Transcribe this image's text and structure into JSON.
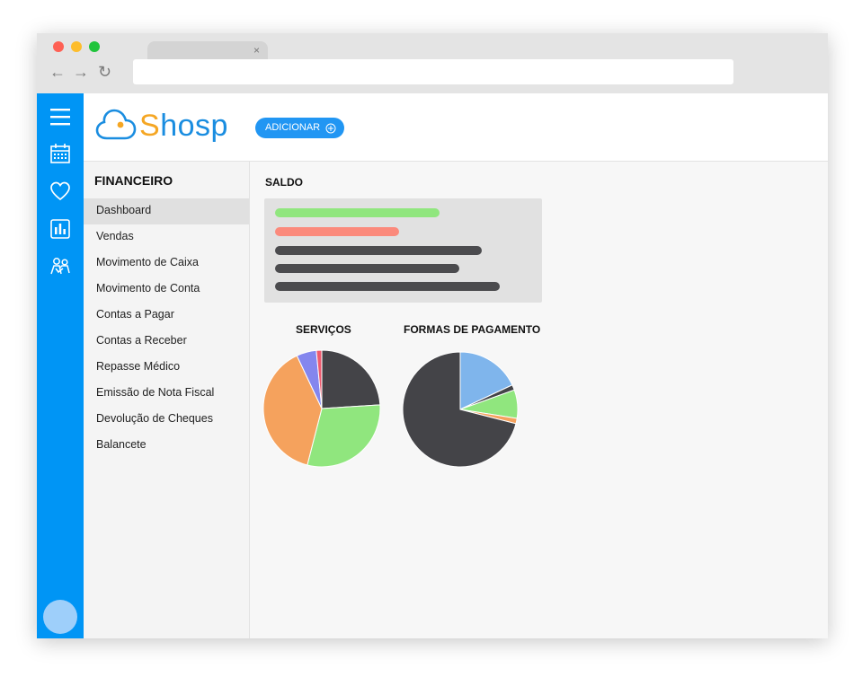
{
  "colors": {
    "accent": "#0095f5",
    "button": "#2196f3",
    "logo_blue": "#1a8de0",
    "logo_orange": "#f5a623",
    "dot_red": "#fe6054",
    "dot_yellow": "#fdbd2c",
    "dot_green": "#20c43b"
  },
  "browser": {
    "tab_close": "×",
    "back_icon": "←",
    "forward_icon": "→",
    "reload_icon": "↻",
    "url": ""
  },
  "sidebar_icons": [
    "menu-icon",
    "calendar-icon",
    "heart-icon",
    "bar-chart-icon",
    "people-icon"
  ],
  "header": {
    "logo_prefix": "S",
    "logo_rest": "hosp",
    "add_button": "ADICIONAR"
  },
  "menu": {
    "title": "FINANCEIRO",
    "items": [
      {
        "label": "Dashboard",
        "active": true
      },
      {
        "label": "Vendas"
      },
      {
        "label": "Movimento de Caixa"
      },
      {
        "label": "Movimento de Conta"
      },
      {
        "label": "Contas a Pagar"
      },
      {
        "label": "Contas a Receber"
      },
      {
        "label": "Repasse Médico"
      },
      {
        "label": "Emissão de Nota Fiscal"
      },
      {
        "label": "Devolução de Cheques"
      },
      {
        "label": "Balancete"
      }
    ]
  },
  "dashboard": {
    "saldo_title": "SALDO",
    "saldo_bars": [
      {
        "color": "#90e67e",
        "fraction": 0.73
      },
      {
        "color": "#fb8a7c",
        "fraction": 0.55
      },
      {
        "color": "#4b4b4e",
        "fraction": 0.92
      },
      {
        "color": "#4b4b4e",
        "fraction": 0.82
      },
      {
        "color": "#4b4b4e",
        "fraction": 1.0
      }
    ],
    "servicos_title": "SERVIÇOS",
    "pagamento_title": "FORMAS DE PAGAMENTO"
  },
  "chart_data": [
    {
      "type": "pie",
      "title": "SERVIÇOS",
      "slices": [
        {
          "value": 24,
          "color": "#444448"
        },
        {
          "value": 30,
          "color": "#90e67e"
        },
        {
          "value": 39,
          "color": "#f5a25d"
        },
        {
          "value": 5.5,
          "color": "#8486ee"
        },
        {
          "value": 1.5,
          "color": "#ee5a6e"
        }
      ]
    },
    {
      "type": "pie",
      "title": "FORMAS DE PAGAMENTO",
      "slices": [
        {
          "value": 18,
          "color": "#7fb5ec"
        },
        {
          "value": 1.5,
          "color": "#444448"
        },
        {
          "value": 8,
          "color": "#90e67e"
        },
        {
          "value": 1.5,
          "color": "#f5a25d"
        },
        {
          "value": 71,
          "color": "#444448"
        }
      ]
    }
  ]
}
